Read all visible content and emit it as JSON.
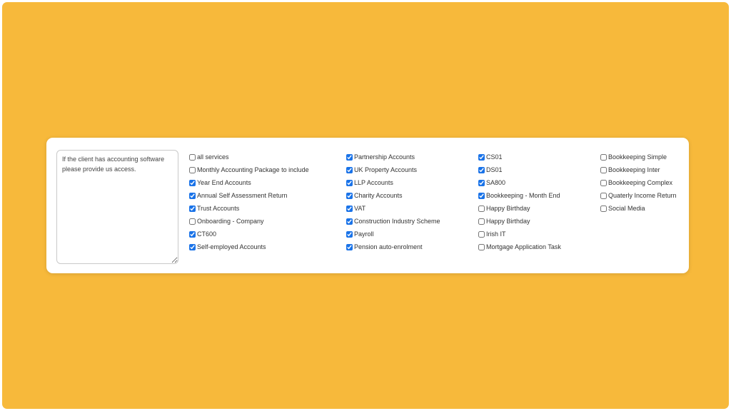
{
  "colors": {
    "background": "#F7B93B",
    "card": "#FFFFFF",
    "checkbox_accent": "#1A73E8"
  },
  "notes": {
    "value": "If the client has accounting software please provide us access."
  },
  "services": {
    "col1": [
      {
        "label": "all services",
        "checked": false
      },
      {
        "label": "Monthly Accounting Package to include",
        "checked": false
      },
      {
        "label": "Year End Accounts",
        "checked": true
      },
      {
        "label": "Annual Self Assessment Return",
        "checked": true
      },
      {
        "label": "Trust Accounts",
        "checked": true
      },
      {
        "label": "Onboarding - Company",
        "checked": false
      },
      {
        "label": "CT600",
        "checked": true
      },
      {
        "label": "Self-employed Accounts",
        "checked": true
      }
    ],
    "col2": [
      {
        "label": "Partnership Accounts",
        "checked": true
      },
      {
        "label": "UK Property Accounts",
        "checked": true
      },
      {
        "label": "LLP Accounts",
        "checked": true
      },
      {
        "label": "Charity Accounts",
        "checked": true
      },
      {
        "label": "VAT",
        "checked": true
      },
      {
        "label": "Construction Industry Scheme",
        "checked": true
      },
      {
        "label": "Payroll",
        "checked": true
      },
      {
        "label": "Pension auto-enrolment",
        "checked": true
      }
    ],
    "col3": [
      {
        "label": "CS01",
        "checked": true
      },
      {
        "label": "DS01",
        "checked": true
      },
      {
        "label": "SA800",
        "checked": true
      },
      {
        "label": "Bookkeeping - Month End",
        "checked": true
      },
      {
        "label": "Happy Birthday",
        "checked": false
      },
      {
        "label": "Happy Birthday",
        "checked": false
      },
      {
        "label": "Irish IT",
        "checked": false
      },
      {
        "label": "Mortgage Application Task",
        "checked": false
      }
    ],
    "col4": [
      {
        "label": "Bookkeeping Simple",
        "checked": false
      },
      {
        "label": "Bookkeeping Inter",
        "checked": false
      },
      {
        "label": "Bookkeeping Complex",
        "checked": false
      },
      {
        "label": "Quaterly Income Return",
        "checked": false
      },
      {
        "label": "Social Media",
        "checked": false
      }
    ]
  }
}
